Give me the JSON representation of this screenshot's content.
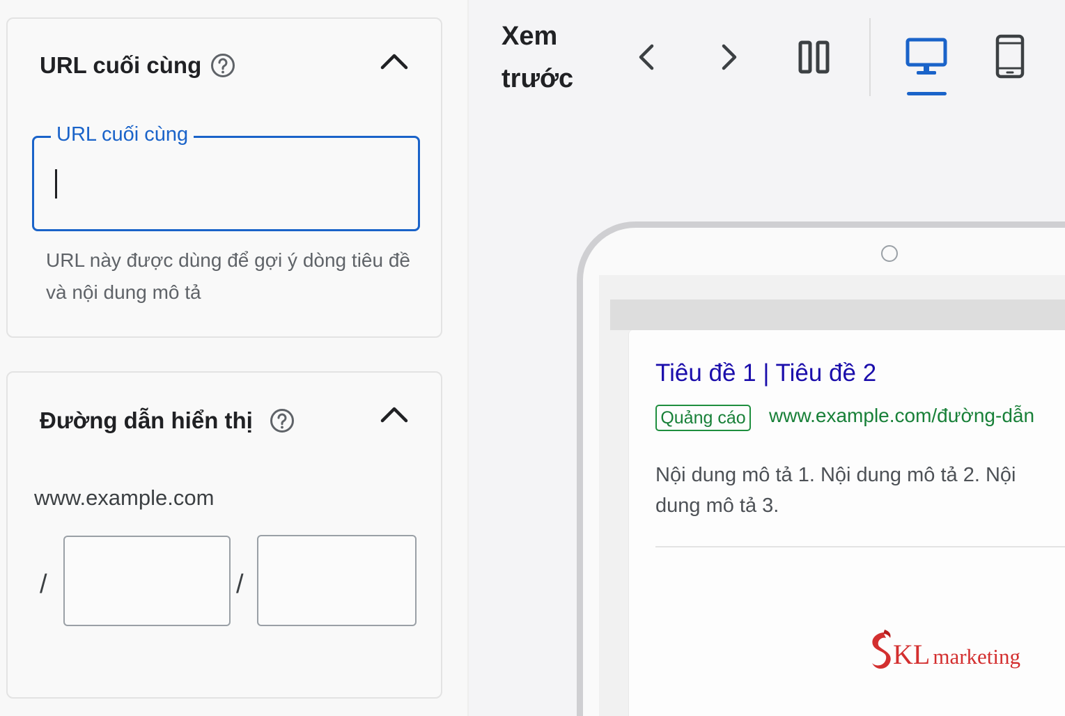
{
  "final_url_section": {
    "title": "URL cuối cùng",
    "field_label": "URL cuối cùng",
    "field_value": "",
    "helper_text": "URL này được dùng để gợi ý dòng tiêu đề và nội dung mô tả"
  },
  "display_path_section": {
    "title": "Đường dẫn hiển thị",
    "domain": "www.example.com",
    "separator": "/",
    "path1_value": "",
    "path2_value": ""
  },
  "preview": {
    "title": "Xem trước",
    "icons": [
      "chevron-left-icon",
      "chevron-right-icon",
      "split-view-icon",
      "desktop-icon",
      "mobile-icon"
    ],
    "selected_device": "desktop"
  },
  "ad": {
    "headline": "Tiêu đề 1 | Tiêu đề 2",
    "badge": "Quảng cáo",
    "display_url": "www.example.com/đường-dẫn",
    "description": "Nội dung mô tả 1. Nội dung mô tả 2. Nội dung mô tả 3."
  },
  "watermark": {
    "brand_initials": "KL",
    "brand_word": "marketing"
  },
  "colors": {
    "accent_blue": "#1a63c9",
    "ad_link": "#1a0dab",
    "ad_green": "#188038",
    "watermark_red": "#d32f2f"
  }
}
